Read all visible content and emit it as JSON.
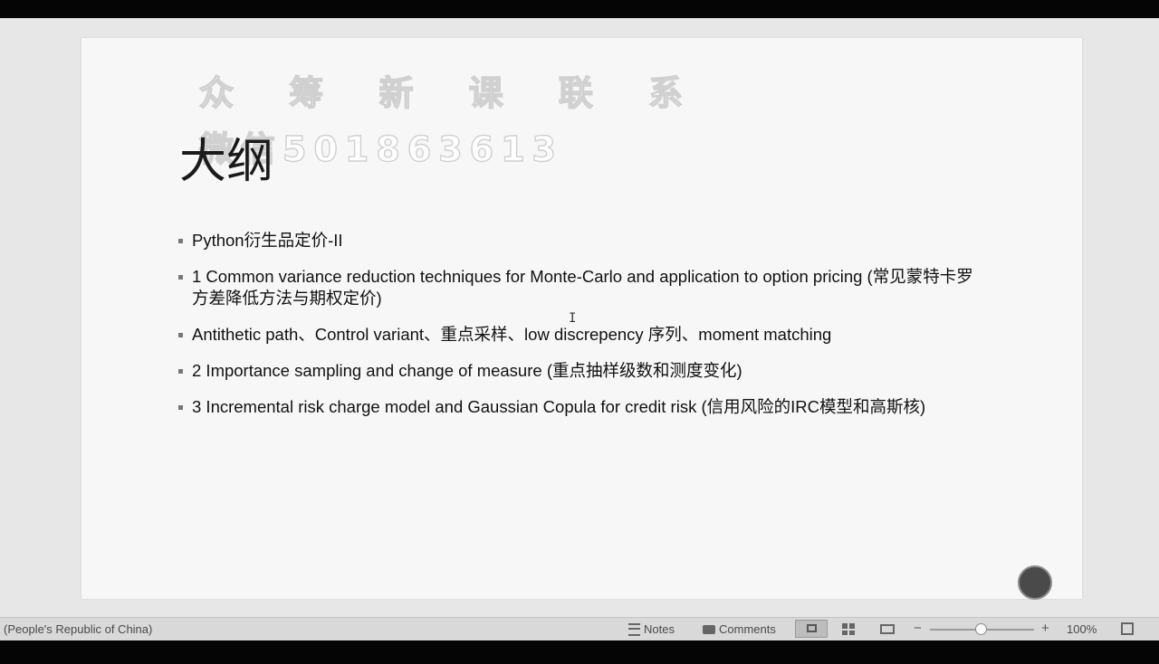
{
  "slide": {
    "watermark_line1": "众 筹 新 课 联 系",
    "watermark_line2": "微信501863613",
    "title": "大纲",
    "bullets": [
      "Python衍生品定价-II",
      "1 Common variance reduction techniques for Monte-Carlo and application to option pricing (常见蒙特卡罗方差降低方法与期权定价)",
      "Antithetic path、Control variant、重点采样、low discrepency 序列、moment matching",
      "2 Importance sampling and change of measure (重点抽样级数和测度变化)",
      "3 Incremental risk charge model and Gaussian Copula for credit risk (信用风险的IRC模型和高斯核)"
    ],
    "cursor_glyph": "I"
  },
  "statusbar": {
    "language": "(People's Republic of China)",
    "notes_label": "Notes",
    "comments_label": "Comments",
    "zoom_minus": "−",
    "zoom_plus": "+",
    "zoom_level": "100%",
    "zoom_value_percent": 100
  },
  "icons": [
    "notes-icon",
    "comments-icon",
    "normal-view-icon",
    "slide-sorter-icon",
    "reading-view-icon",
    "fit-to-window-icon"
  ]
}
